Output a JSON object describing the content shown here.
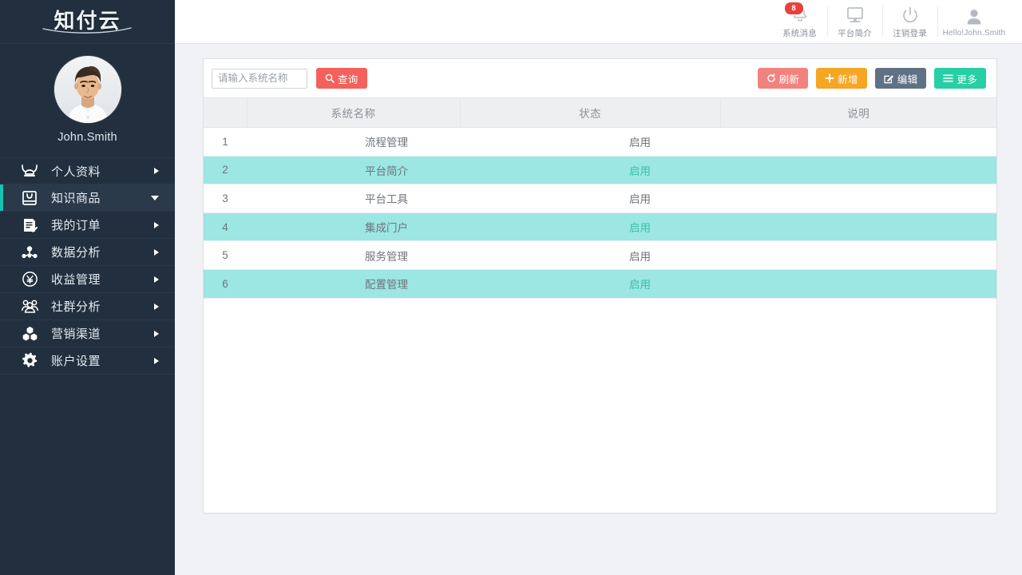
{
  "brand": {
    "logo_text": "知付云"
  },
  "profile": {
    "name": "John.Smith",
    "avatar": "user-photo-avatar"
  },
  "sidebar": {
    "items": [
      {
        "label": "个人资料",
        "icon": "profile-icon",
        "arrow": "right",
        "active": false
      },
      {
        "label": "知识商品",
        "icon": "bag-icon",
        "arrow": "down",
        "active": true
      },
      {
        "label": "我的订单",
        "icon": "order-doc-icon",
        "arrow": "right",
        "active": false
      },
      {
        "label": "数据分析",
        "icon": "network-icon",
        "arrow": "right",
        "active": false
      },
      {
        "label": "收益管理",
        "icon": "yen-circle-icon",
        "arrow": "right",
        "active": false
      },
      {
        "label": "社群分析",
        "icon": "group-icon",
        "arrow": "right",
        "active": false
      },
      {
        "label": "营销渠道",
        "icon": "hexagons-icon",
        "arrow": "right",
        "active": false
      },
      {
        "label": "账户设置",
        "icon": "gear-icon",
        "arrow": "right",
        "active": false
      }
    ]
  },
  "header": {
    "actions": [
      {
        "label": "系统消息",
        "icon": "bell-icon",
        "badge": "8"
      },
      {
        "label": "平台简介",
        "icon": "monitor-icon",
        "badge": ""
      },
      {
        "label": "注销登录",
        "icon": "power-icon",
        "badge": ""
      },
      {
        "label": "Hello!John.Smith",
        "icon": "user-avatar-icon",
        "badge": ""
      }
    ]
  },
  "toolbar": {
    "search_placeholder": "请输入系统名称",
    "search_value": "",
    "query_label": "查询",
    "refresh_label": "刷新",
    "add_label": "新增",
    "edit_label": "编辑",
    "more_label": "更多"
  },
  "table": {
    "columns": [
      "",
      "系统名称",
      "状态",
      "说明"
    ],
    "rows": [
      {
        "idx": "1",
        "name": "流程管理",
        "status": "启用",
        "desc": ""
      },
      {
        "idx": "2",
        "name": "平台简介",
        "status": "启用",
        "desc": ""
      },
      {
        "idx": "3",
        "name": "平台工具",
        "status": "启用",
        "desc": ""
      },
      {
        "idx": "4",
        "name": "集成门户",
        "status": "启用",
        "desc": ""
      },
      {
        "idx": "5",
        "name": "服务管理",
        "status": "启用",
        "desc": ""
      },
      {
        "idx": "6",
        "name": "配置管理",
        "status": "启用",
        "desc": ""
      }
    ]
  },
  "colors": {
    "sidebar_bg": "#222f3e",
    "accent_teal": "#17c3b2",
    "row_highlight": "#9ce6e4",
    "status_text": "#35c5ad",
    "btn_query": "#f4605b",
    "btn_refresh": "#f1837f",
    "btn_add": "#f5a623",
    "btn_edit": "#5f7184",
    "btn_more": "#27cfa4",
    "badge_red": "#e8413c",
    "page_bg": "#f1f2f6"
  }
}
